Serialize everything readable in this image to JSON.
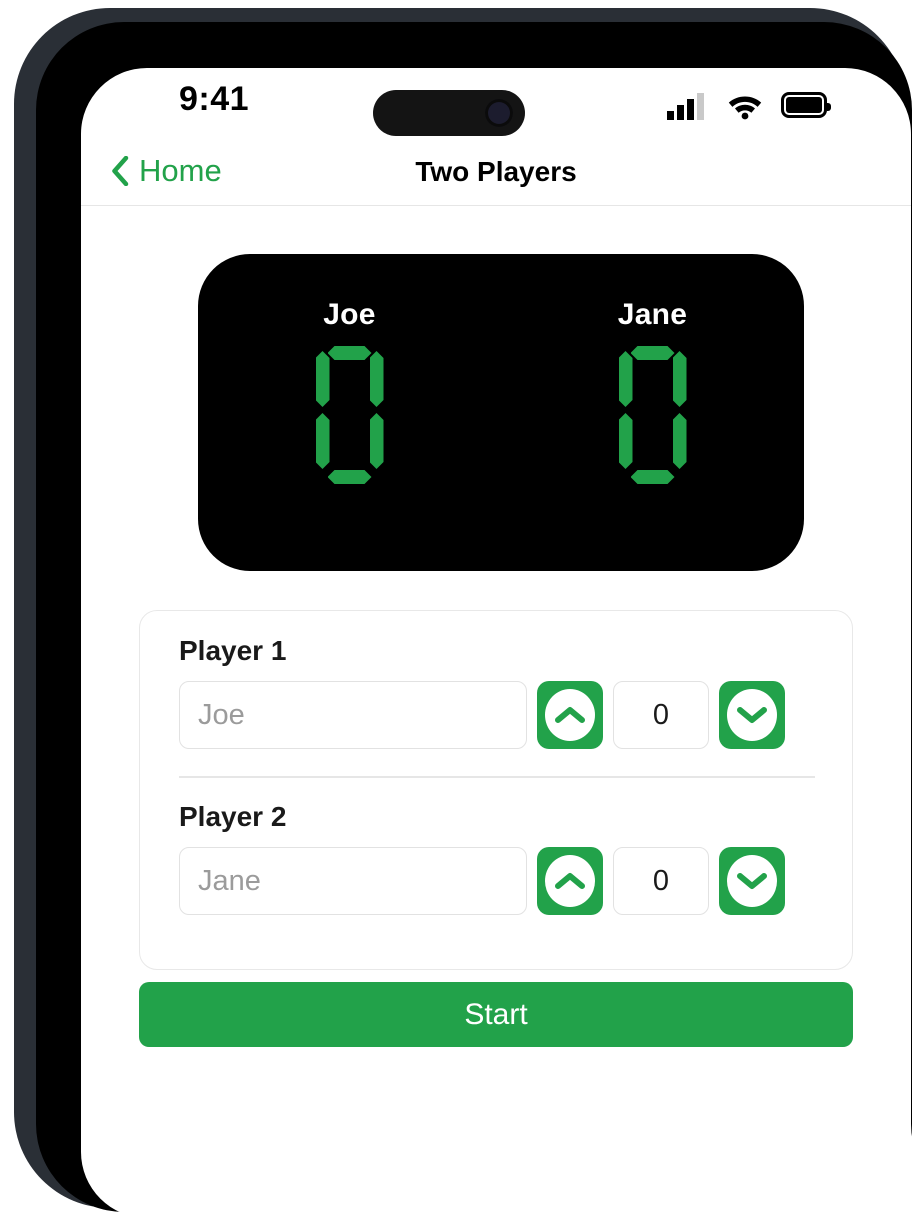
{
  "status_bar": {
    "time": "9:41",
    "signal_icon": "cellular-signal-icon",
    "wifi_icon": "wifi-icon",
    "battery_icon": "battery-full-icon"
  },
  "nav_bar": {
    "back_label": "Home",
    "back_icon": "chevron-left-icon",
    "title": "Two Players"
  },
  "scoreboard": {
    "players": [
      {
        "name": "Joe",
        "score": "0"
      },
      {
        "name": "Jane",
        "score": "0"
      }
    ],
    "background_color": "#000000",
    "digit_color": "#22a24a",
    "name_color": "#ffffff"
  },
  "form": {
    "rows": [
      {
        "label": "Player 1",
        "name_placeholder": "Joe",
        "name_value": "",
        "score_value": "0",
        "increment_icon": "chevron-up-circle-icon",
        "decrement_icon": "chevron-down-circle-icon"
      },
      {
        "label": "Player 2",
        "name_placeholder": "Jane",
        "name_value": "",
        "score_value": "0",
        "increment_icon": "chevron-up-circle-icon",
        "decrement_icon": "chevron-down-circle-icon"
      }
    ]
  },
  "actions": {
    "start_label": "Start"
  },
  "theme": {
    "accent": "#22a24a",
    "text": "#1a1a1a",
    "placeholder": "#9b9b9b",
    "border": "#e2e2e2"
  }
}
